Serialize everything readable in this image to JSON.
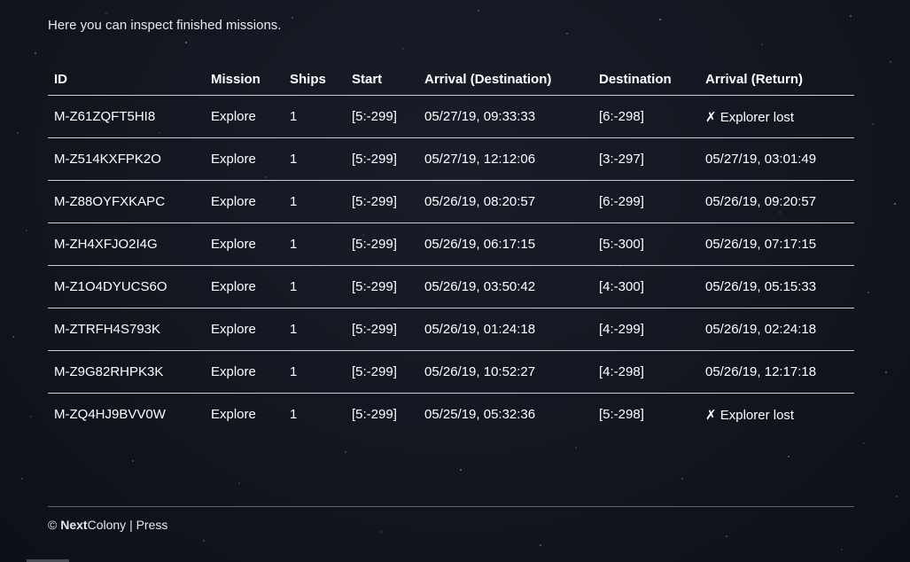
{
  "intro_text": "Here you can inspect finished missions.",
  "table": {
    "headers": [
      "ID",
      "Mission",
      "Ships",
      "Start",
      "Arrival (Destination)",
      "Destination",
      "Arrival (Return)"
    ],
    "rows": [
      {
        "id": "M-Z61ZQFT5HI8",
        "mission": "Explore",
        "ships": "1",
        "start": "[5:-299]",
        "arrival_destination": "05/27/19, 09:33:33",
        "destination": "[6:-298]",
        "arrival_return": "✗ Explorer lost"
      },
      {
        "id": "M-Z514KXFPK2O",
        "mission": "Explore",
        "ships": "1",
        "start": "[5:-299]",
        "arrival_destination": "05/27/19, 12:12:06",
        "destination": "[3:-297]",
        "arrival_return": "05/27/19, 03:01:49"
      },
      {
        "id": "M-Z88OYFXKAPC",
        "mission": "Explore",
        "ships": "1",
        "start": "[5:-299]",
        "arrival_destination": "05/26/19, 08:20:57",
        "destination": "[6:-299]",
        "arrival_return": "05/26/19, 09:20:57"
      },
      {
        "id": "M-ZH4XFJO2I4G",
        "mission": "Explore",
        "ships": "1",
        "start": "[5:-299]",
        "arrival_destination": "05/26/19, 06:17:15",
        "destination": "[5:-300]",
        "arrival_return": "05/26/19, 07:17:15"
      },
      {
        "id": "M-Z1O4DYUCS6O",
        "mission": "Explore",
        "ships": "1",
        "start": "[5:-299]",
        "arrival_destination": "05/26/19, 03:50:42",
        "destination": "[4:-300]",
        "arrival_return": "05/26/19, 05:15:33"
      },
      {
        "id": "M-ZTRFH4S793K",
        "mission": "Explore",
        "ships": "1",
        "start": "[5:-299]",
        "arrival_destination": "05/26/19, 01:24:18",
        "destination": "[4:-299]",
        "arrival_return": "05/26/19, 02:24:18"
      },
      {
        "id": "M-Z9G82RHPK3K",
        "mission": "Explore",
        "ships": "1",
        "start": "[5:-299]",
        "arrival_destination": "05/26/19, 10:52:27",
        "destination": "[4:-298]",
        "arrival_return": "05/26/19, 12:17:18"
      },
      {
        "id": "M-ZQ4HJ9BVV0W",
        "mission": "Explore",
        "ships": "1",
        "start": "[5:-299]",
        "arrival_destination": "05/25/19, 05:32:36",
        "destination": "[5:-298]",
        "arrival_return": "✗ Explorer lost"
      }
    ]
  },
  "footer": {
    "copyright": "©",
    "brand_bold": "Next",
    "brand_rest": "Colony",
    "separator": "|",
    "press_link": "Press"
  },
  "colors": {
    "background": "#13151f",
    "text": "#ffffff",
    "row_divider": "#c9cbd3"
  }
}
